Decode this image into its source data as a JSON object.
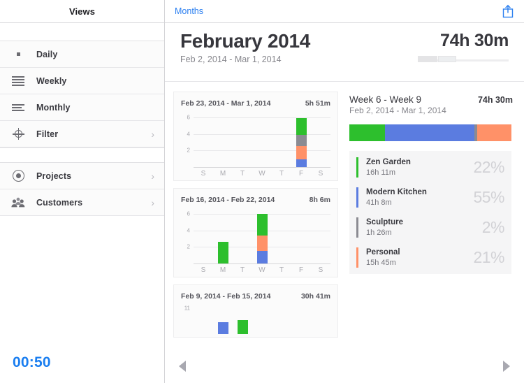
{
  "sidebar": {
    "title": "Views",
    "items": [
      {
        "label": "Daily",
        "icon": "daily-icon",
        "chevron": false
      },
      {
        "label": "Weekly",
        "icon": "weekly-icon",
        "chevron": false
      },
      {
        "label": "Monthly",
        "icon": "monthly-icon",
        "chevron": false
      },
      {
        "label": "Filter",
        "icon": "crosshair-icon",
        "chevron": true,
        "chevron_glyph": "›"
      }
    ],
    "items2": [
      {
        "label": "Projects",
        "icon": "target-icon",
        "chevron": true,
        "chevron_glyph": "›"
      },
      {
        "label": "Customers",
        "icon": "people-icon",
        "chevron": true,
        "chevron_glyph": "›"
      }
    ],
    "timer": "00:50",
    "timer_color": "#1a7ef0"
  },
  "topbar": {
    "breadcrumb": "Months",
    "share_icon": "share-icon",
    "accent": "#2b7ff0"
  },
  "header": {
    "title": "February 2014",
    "subtitle": "Feb 2, 2014 - Mar 1, 2014",
    "total": "74h 30m"
  },
  "summary": {
    "title": "Week 6 - Week 9",
    "subtitle": "Feb 2, 2014 - Mar 1, 2014",
    "total": "74h 30m",
    "projects": [
      {
        "name": "Zen Garden",
        "time": "16h 11m",
        "percent": "22%",
        "value": 22,
        "color": "#2dbf2d"
      },
      {
        "name": "Modern Kitchen",
        "time": "41h 8m",
        "percent": "55%",
        "value": 55,
        "color": "#5b7ce0"
      },
      {
        "name": "Sculpture",
        "time": "1h 26m",
        "percent": "2%",
        "value": 2,
        "color": "#8b8b92"
      },
      {
        "name": "Personal",
        "time": "15h 45m",
        "percent": "21%",
        "value": 21,
        "color": "#ff9168"
      }
    ]
  },
  "bottom_nav": {
    "prev_icon": "arrow-left-icon",
    "next_icon": "arrow-right-icon"
  },
  "chart_data": [
    {
      "type": "bar",
      "title": "Feb 23, 2014 - Mar 1, 2014",
      "total": "5h 51m",
      "categories": [
        "S",
        "M",
        "T",
        "W",
        "T",
        "F",
        "S"
      ],
      "ylim": [
        0,
        6.5
      ],
      "yticks": [
        2,
        4,
        6
      ],
      "grid": true,
      "stacked": true,
      "series": [
        {
          "name": "Modern Kitchen",
          "color": "#5b7ce0",
          "values": [
            0,
            0,
            0,
            0,
            0,
            0.9,
            0
          ]
        },
        {
          "name": "Personal",
          "color": "#ff9168",
          "values": [
            0,
            0,
            0,
            0,
            0,
            1.6,
            0
          ]
        },
        {
          "name": "Sculpture",
          "color": "#8b8b92",
          "values": [
            0,
            0,
            0,
            0,
            0,
            1.4,
            0
          ]
        },
        {
          "name": "Zen Garden",
          "color": "#2dbf2d",
          "values": [
            0,
            0,
            0,
            0,
            0,
            2.0,
            0
          ]
        }
      ]
    },
    {
      "type": "bar",
      "title": "Feb 16, 2014 - Feb 22, 2014",
      "total": "8h 6m",
      "categories": [
        "S",
        "M",
        "T",
        "W",
        "T",
        "F",
        "S"
      ],
      "ylim": [
        0,
        6.5
      ],
      "yticks": [
        2,
        4,
        6
      ],
      "grid": true,
      "stacked": true,
      "series": [
        {
          "name": "Modern Kitchen",
          "color": "#5b7ce0",
          "values": [
            0,
            0,
            0,
            1.5,
            0,
            0,
            0
          ]
        },
        {
          "name": "Personal",
          "color": "#ff9168",
          "values": [
            0,
            0,
            0,
            1.9,
            0,
            0,
            0
          ]
        },
        {
          "name": "Zen Garden",
          "color": "#2dbf2d",
          "values": [
            0,
            2.6,
            0,
            2.6,
            0,
            0,
            0
          ]
        }
      ]
    },
    {
      "type": "bar",
      "title": "Feb 9, 2014 - Feb 15, 2014",
      "total": "30h 41m",
      "categories": [],
      "ylim": [
        0,
        12
      ],
      "yticks": [
        11
      ],
      "grid": false,
      "stacked": true,
      "clipped": true,
      "series": [
        {
          "name": "Modern Kitchen",
          "color": "#5b7ce0",
          "values": [
            0,
            5,
            0,
            0,
            0,
            0,
            0
          ]
        },
        {
          "name": "Zen Garden",
          "color": "#2dbf2d",
          "values": [
            0,
            0,
            6,
            0,
            0,
            0,
            0
          ]
        }
      ]
    }
  ]
}
